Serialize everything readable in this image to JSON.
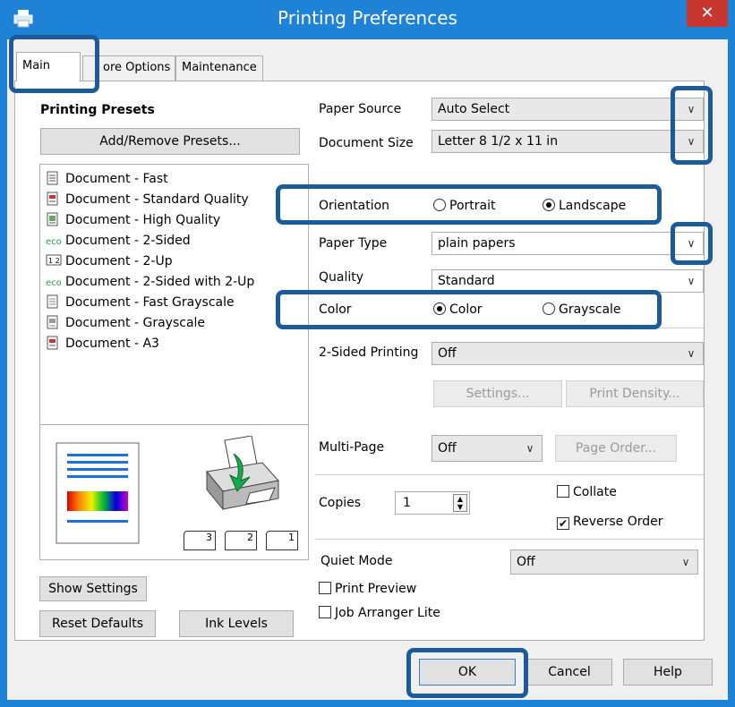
{
  "window": {
    "title": "Printing Preferences",
    "close_glyph": "✕"
  },
  "tabs": [
    {
      "label": "Main",
      "active": true
    },
    {
      "label": "ore Options",
      "active": false
    },
    {
      "label": "Maintenance",
      "active": false
    }
  ],
  "presets": {
    "heading": "Printing Presets",
    "add_remove_label": "Add/Remove Presets...",
    "items": [
      {
        "label": "Document - Fast",
        "icon": "document-icon"
      },
      {
        "label": "Document - Standard Quality",
        "icon": "document-icon"
      },
      {
        "label": "Document - High Quality",
        "icon": "document-photo-icon"
      },
      {
        "label": "Document - 2-Sided",
        "icon": "eco-icon"
      },
      {
        "label": "Document - 2-Up",
        "icon": "two-up-icon"
      },
      {
        "label": "Document - 2-Sided with 2-Up",
        "icon": "eco-icon"
      },
      {
        "label": "Document - Fast Grayscale",
        "icon": "document-gray-icon"
      },
      {
        "label": "Document - Grayscale",
        "icon": "document-gray-icon"
      },
      {
        "label": "Document - A3",
        "icon": "document-icon"
      }
    ]
  },
  "settings": {
    "paper_source_label": "Paper Source",
    "paper_source_value": "Auto Select",
    "document_size_label": "Document Size",
    "document_size_value": "Letter 8 1/2 x 11 in",
    "orientation_label": "Orientation",
    "orientation_portrait": "Portrait",
    "orientation_landscape": "Landscape",
    "orientation_selected": "Landscape",
    "paper_type_label": "Paper Type",
    "paper_type_value": "plain papers",
    "quality_label": "Quality",
    "quality_value": "Standard",
    "color_label": "Color",
    "color_color": "Color",
    "color_grayscale": "Grayscale",
    "color_selected": "Color",
    "two_sided_label": "2-Sided Printing",
    "two_sided_value": "Off",
    "settings_button": "Settings...",
    "print_density_button": "Print Density...",
    "multi_page_label": "Multi-Page",
    "multi_page_value": "Off",
    "page_order_button": "Page Order...",
    "copies_label": "Copies",
    "copies_value": "1",
    "collate_label": "Collate",
    "collate_checked": false,
    "reverse_order_label": "Reverse Order",
    "reverse_order_checked": true,
    "quiet_mode_label": "Quiet Mode",
    "quiet_mode_value": "Off",
    "print_preview_label": "Print Preview",
    "print_preview_checked": false,
    "job_arranger_label": "Job Arranger Lite",
    "job_arranger_checked": false
  },
  "left_buttons": {
    "show_settings": "Show Settings",
    "reset_defaults": "Reset Defaults",
    "ink_levels": "Ink Levels"
  },
  "page_stack_labels": [
    "3",
    "2",
    "1"
  ],
  "footer": {
    "ok": "OK",
    "cancel": "Cancel",
    "help": "Help"
  },
  "colors": {
    "titlebar": "#1e82d7",
    "close": "#c7372f",
    "highlight": "#1c5b9a"
  }
}
